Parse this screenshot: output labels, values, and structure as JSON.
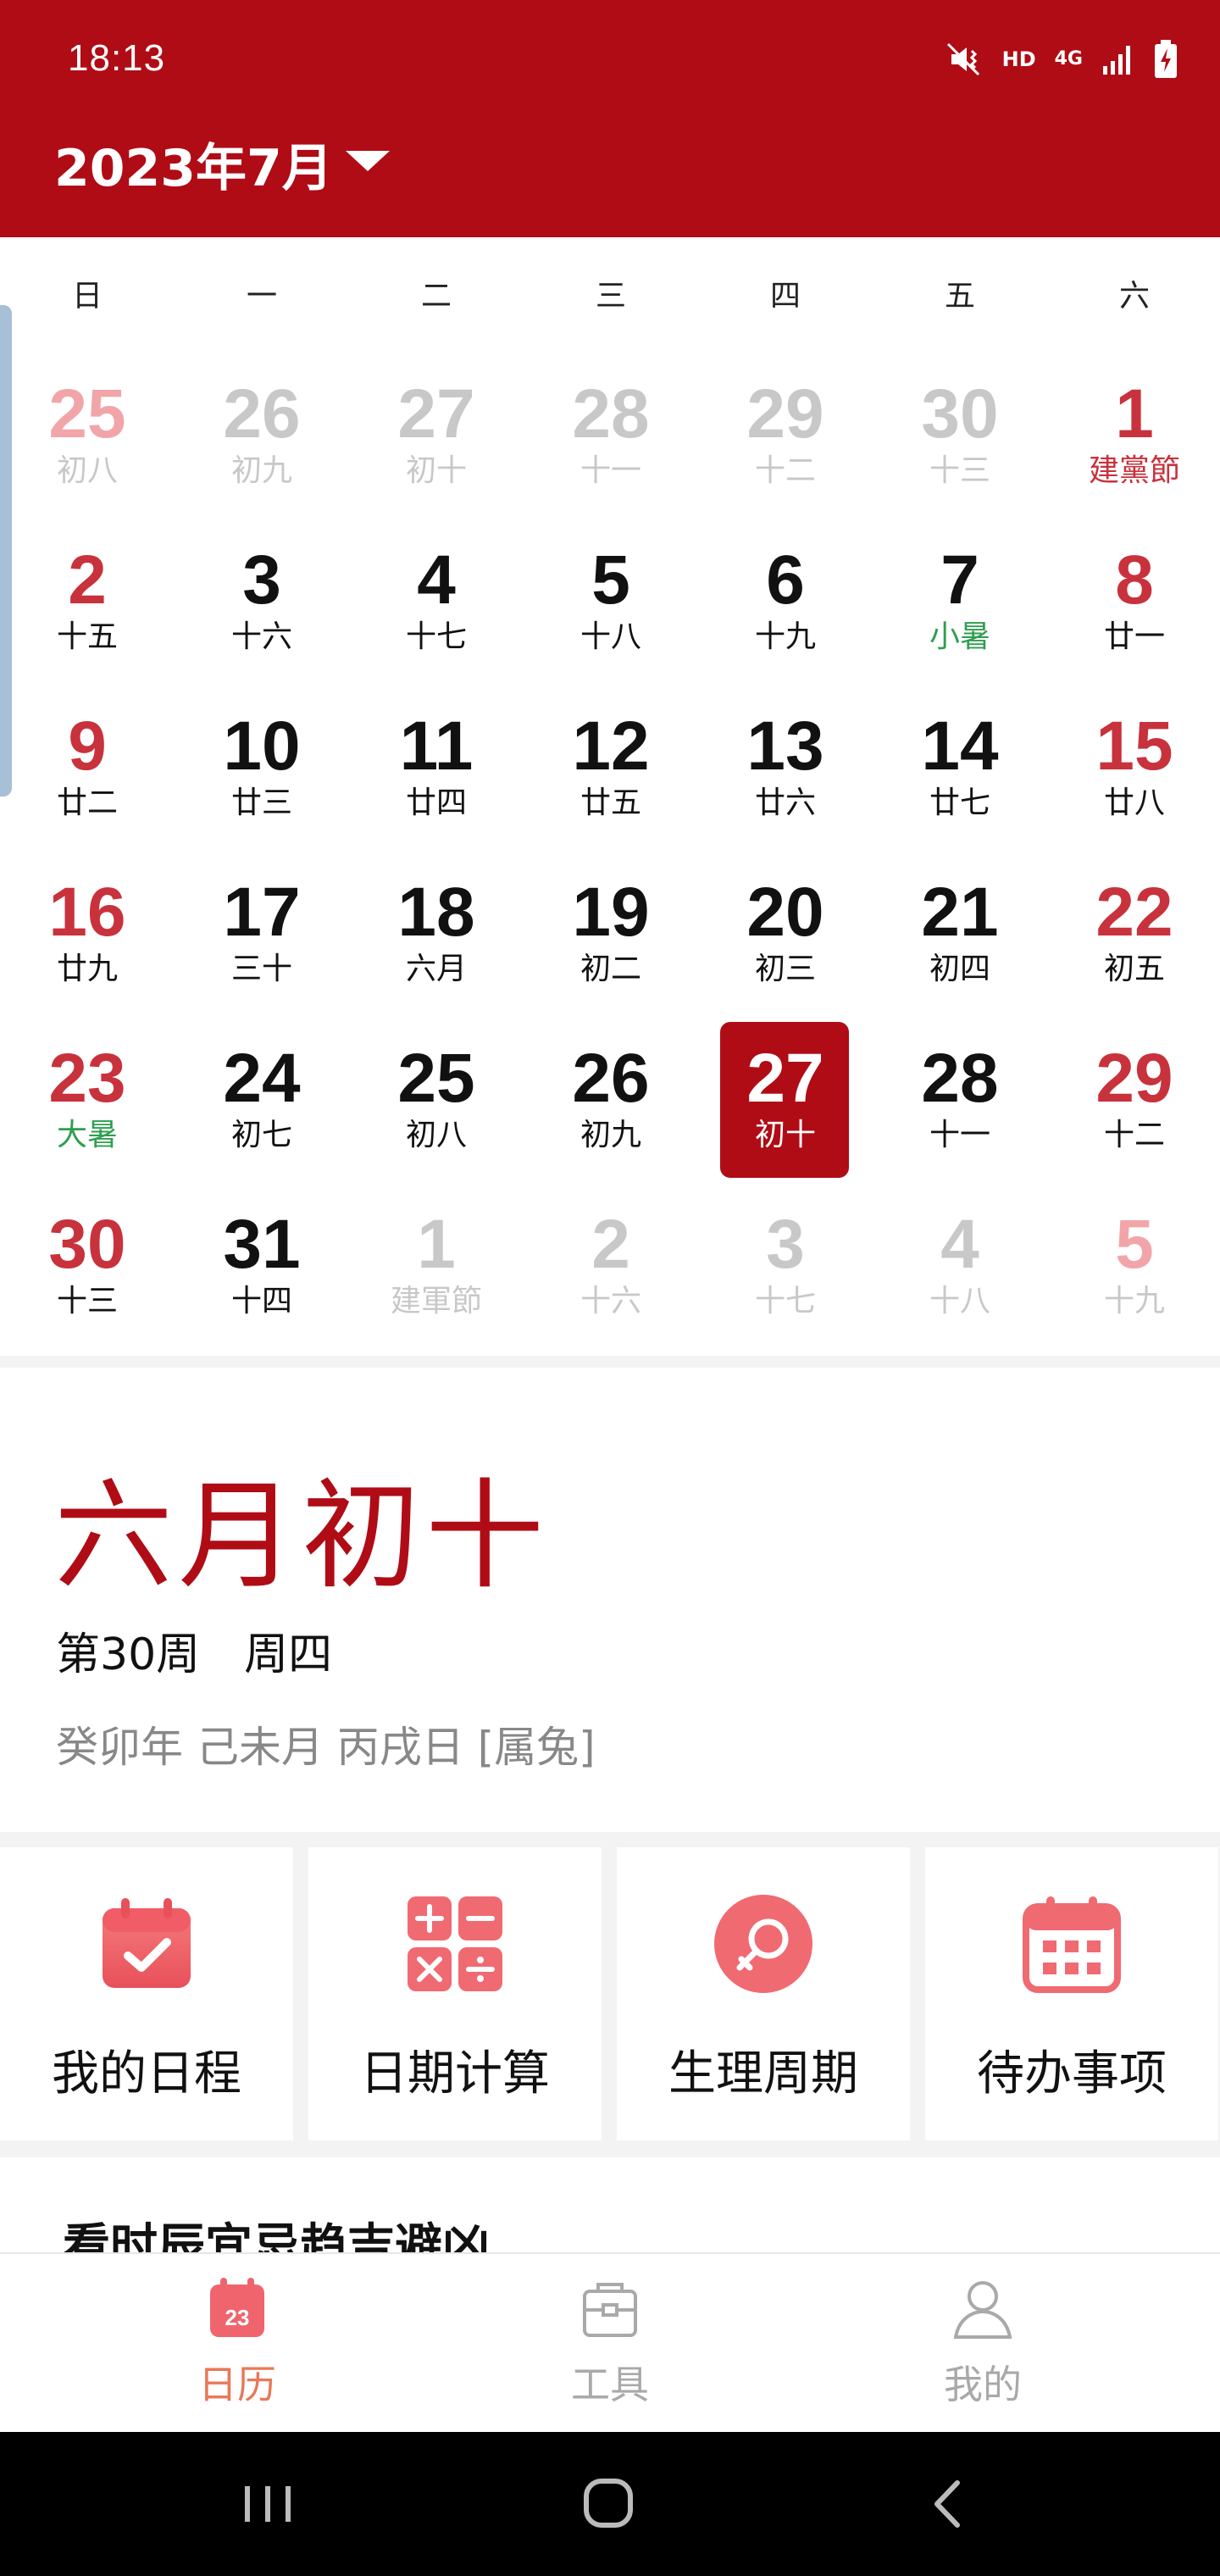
{
  "status_bar": {
    "time": "18:13",
    "hd": "HD",
    "network": "4G"
  },
  "header": {
    "month_title": "2023年7月"
  },
  "colors": {
    "brand": "#B00C16",
    "holiday_red": "#C8323C",
    "term_green": "#2E9E4F",
    "faded": "#C8C8C8",
    "faded_red": "#F2A5A9",
    "nav_active": "#E8795A",
    "nav_inactive": "#A9A9A9"
  },
  "weekdays": [
    "日",
    "一",
    "二",
    "三",
    "四",
    "五",
    "六"
  ],
  "days": [
    {
      "day": "25",
      "sub": "初八",
      "type": "prev-weekend"
    },
    {
      "day": "26",
      "sub": "初九",
      "type": "prev"
    },
    {
      "day": "27",
      "sub": "初十",
      "type": "prev"
    },
    {
      "day": "28",
      "sub": "十一",
      "type": "prev"
    },
    {
      "day": "29",
      "sub": "十二",
      "type": "prev"
    },
    {
      "day": "30",
      "sub": "十三",
      "type": "prev"
    },
    {
      "day": "1",
      "sub": "建黨節",
      "type": "weekend-festival"
    },
    {
      "day": "2",
      "sub": "十五",
      "type": "weekend"
    },
    {
      "day": "3",
      "sub": "十六",
      "type": "normal"
    },
    {
      "day": "4",
      "sub": "十七",
      "type": "normal"
    },
    {
      "day": "5",
      "sub": "十八",
      "type": "normal"
    },
    {
      "day": "6",
      "sub": "十九",
      "type": "normal"
    },
    {
      "day": "7",
      "sub": "小暑",
      "type": "term"
    },
    {
      "day": "8",
      "sub": "廿一",
      "type": "weekend"
    },
    {
      "day": "9",
      "sub": "廿二",
      "type": "weekend"
    },
    {
      "day": "10",
      "sub": "廿三",
      "type": "normal"
    },
    {
      "day": "11",
      "sub": "廿四",
      "type": "normal"
    },
    {
      "day": "12",
      "sub": "廿五",
      "type": "normal"
    },
    {
      "day": "13",
      "sub": "廿六",
      "type": "normal"
    },
    {
      "day": "14",
      "sub": "廿七",
      "type": "normal"
    },
    {
      "day": "15",
      "sub": "廿八",
      "type": "weekend"
    },
    {
      "day": "16",
      "sub": "廿九",
      "type": "weekend"
    },
    {
      "day": "17",
      "sub": "三十",
      "type": "normal"
    },
    {
      "day": "18",
      "sub": "六月",
      "type": "normal"
    },
    {
      "day": "19",
      "sub": "初二",
      "type": "normal"
    },
    {
      "day": "20",
      "sub": "初三",
      "type": "normal"
    },
    {
      "day": "21",
      "sub": "初四",
      "type": "normal"
    },
    {
      "day": "22",
      "sub": "初五",
      "type": "weekend"
    },
    {
      "day": "23",
      "sub": "大暑",
      "type": "weekend-term"
    },
    {
      "day": "24",
      "sub": "初七",
      "type": "normal"
    },
    {
      "day": "25",
      "sub": "初八",
      "type": "normal"
    },
    {
      "day": "26",
      "sub": "初九",
      "type": "normal"
    },
    {
      "day": "27",
      "sub": "初十",
      "type": "selected"
    },
    {
      "day": "28",
      "sub": "十一",
      "type": "normal"
    },
    {
      "day": "29",
      "sub": "十二",
      "type": "weekend"
    },
    {
      "day": "30",
      "sub": "十三",
      "type": "weekend"
    },
    {
      "day": "31",
      "sub": "十四",
      "type": "normal"
    },
    {
      "day": "1",
      "sub": "建軍節",
      "type": "next"
    },
    {
      "day": "2",
      "sub": "十六",
      "type": "next"
    },
    {
      "day": "3",
      "sub": "十七",
      "type": "next"
    },
    {
      "day": "4",
      "sub": "十八",
      "type": "next"
    },
    {
      "day": "5",
      "sub": "十九",
      "type": "next-weekend"
    }
  ],
  "detail": {
    "lunar_date": "六月初十",
    "week_info": "第30周　周四",
    "ganzhi": "癸卯年 己未月 丙戌日 [属兔]"
  },
  "tools": [
    {
      "label": "我的日程",
      "icon": "calendar-check-icon"
    },
    {
      "label": "日期计算",
      "icon": "calculator-icon"
    },
    {
      "label": "生理周期",
      "icon": "female-symbol-icon"
    },
    {
      "label": "待办事项",
      "icon": "calendar-grid-icon"
    }
  ],
  "section_title": "看时辰宜忌趋吉避凶",
  "bottom_nav": [
    {
      "label": "日历",
      "icon": "calendar-icon",
      "icon_text": "23",
      "active": true
    },
    {
      "label": "工具",
      "icon": "toolbox-icon",
      "active": false
    },
    {
      "label": "我的",
      "icon": "person-icon",
      "active": false
    }
  ]
}
